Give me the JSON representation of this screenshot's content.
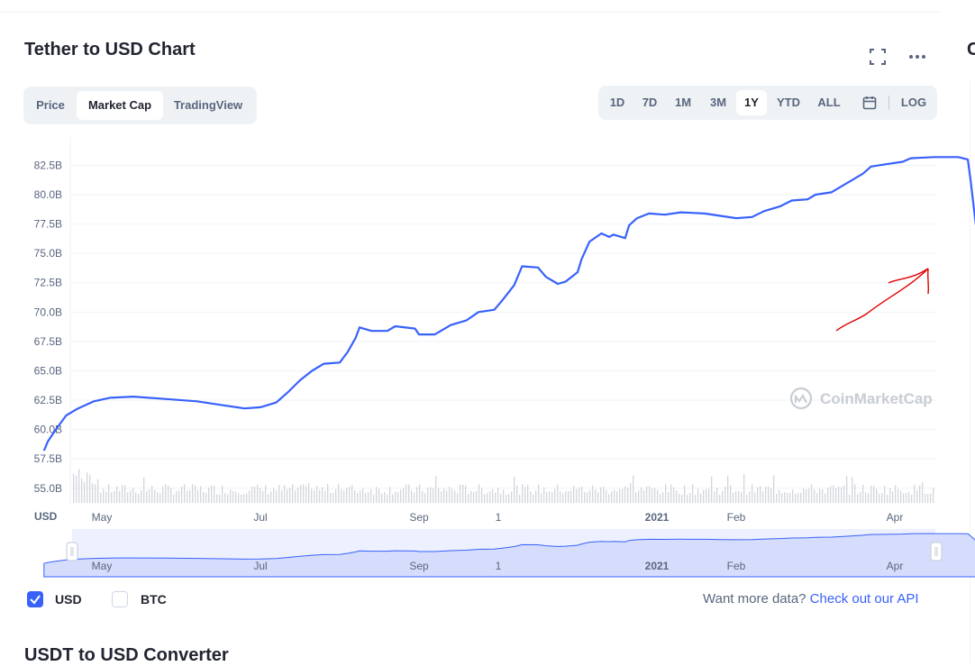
{
  "header": {
    "title": "Tether to USD Chart",
    "right_edge_char": "C"
  },
  "tabs": [
    {
      "label": "Price",
      "active": false
    },
    {
      "label": "Market Cap",
      "active": true
    },
    {
      "label": "TradingView",
      "active": false
    }
  ],
  "ranges": [
    {
      "label": "1D",
      "active": false
    },
    {
      "label": "7D",
      "active": false
    },
    {
      "label": "1M",
      "active": false
    },
    {
      "label": "3M",
      "active": false
    },
    {
      "label": "1Y",
      "active": true
    },
    {
      "label": "YTD",
      "active": false
    },
    {
      "label": "ALL",
      "active": false
    }
  ],
  "log_label": "LOG",
  "icons": [
    "fullscreen-icon",
    "more-icon",
    "calendar-icon",
    "coinmarketcap-logo-icon"
  ],
  "watermark": "CoinMarketCap",
  "legend": {
    "usd_label": "USD",
    "btc_label": "BTC",
    "usd_checked": true,
    "btc_checked": false
  },
  "more_data": {
    "text": "Want more data?",
    "link": "Check out our API"
  },
  "converter_title": "USDT to USD Converter",
  "colors": {
    "line": "#3861fb",
    "accent": "#3861fb",
    "annotation": "#e10000",
    "grid": "#eff2f5",
    "label": "#58667e"
  },
  "chart_data": {
    "type": "line",
    "y_unit_label": "USD",
    "ylim": [
      53.6,
      84.3
    ],
    "yticks": [
      "55.0B",
      "57.5B",
      "60.0B",
      "62.5B",
      "65.0B",
      "67.5B",
      "70.0B",
      "72.5B",
      "75.0B",
      "77.5B",
      "80.0B",
      "82.5B"
    ],
    "ytick_values": [
      55.0,
      57.5,
      60.0,
      62.5,
      65.0,
      67.5,
      70.0,
      72.5,
      75.0,
      77.5,
      80.0,
      82.5
    ],
    "xticks": [
      {
        "label": "May",
        "x": 1.0,
        "bold": false
      },
      {
        "label": "Jul",
        "x": 3.0,
        "bold": false
      },
      {
        "label": "Sep",
        "x": 5.0,
        "bold": false
      },
      {
        "label": "1",
        "x": 6.0,
        "bold": false
      },
      {
        "label": "2021",
        "x": 8.0,
        "bold": true
      },
      {
        "label": "Feb",
        "x": 9.0,
        "bold": false
      },
      {
        "label": "Apr",
        "x": 11.0,
        "bold": false
      }
    ],
    "xlim": [
      0.27,
      11.55
    ],
    "series": [
      {
        "values": [
          [
            0.27,
            58.2
          ],
          [
            0.32,
            59.0
          ],
          [
            0.42,
            60.0
          ],
          [
            0.55,
            61.2
          ],
          [
            0.7,
            61.8
          ],
          [
            0.9,
            62.4
          ],
          [
            1.1,
            62.7
          ],
          [
            1.4,
            62.8
          ],
          [
            1.8,
            62.6
          ],
          [
            2.2,
            62.4
          ],
          [
            2.5,
            62.1
          ],
          [
            2.8,
            61.8
          ],
          [
            3.0,
            61.9
          ],
          [
            3.2,
            62.3
          ],
          [
            3.35,
            63.2
          ],
          [
            3.5,
            64.2
          ],
          [
            3.65,
            65.0
          ],
          [
            3.8,
            65.6
          ],
          [
            4.0,
            65.7
          ],
          [
            4.1,
            66.6
          ],
          [
            4.2,
            67.8
          ],
          [
            4.25,
            68.7
          ],
          [
            4.4,
            68.4
          ],
          [
            4.6,
            68.4
          ],
          [
            4.7,
            68.8
          ],
          [
            4.95,
            68.6
          ],
          [
            5.0,
            68.1
          ],
          [
            5.2,
            68.1
          ],
          [
            5.4,
            68.9
          ],
          [
            5.6,
            69.3
          ],
          [
            5.75,
            70.0
          ],
          [
            5.95,
            70.2
          ],
          [
            6.05,
            71.0
          ],
          [
            6.2,
            72.3
          ],
          [
            6.3,
            73.9
          ],
          [
            6.5,
            73.8
          ],
          [
            6.6,
            73.0
          ],
          [
            6.75,
            72.4
          ],
          [
            6.85,
            72.6
          ],
          [
            7.0,
            73.4
          ],
          [
            7.05,
            74.5
          ],
          [
            7.15,
            76.0
          ],
          [
            7.3,
            76.7
          ],
          [
            7.4,
            76.4
          ],
          [
            7.45,
            76.6
          ],
          [
            7.6,
            76.3
          ],
          [
            7.65,
            77.4
          ],
          [
            7.75,
            78.0
          ],
          [
            7.9,
            78.4
          ],
          [
            8.1,
            78.3
          ],
          [
            8.3,
            78.5
          ],
          [
            8.6,
            78.4
          ],
          [
            8.8,
            78.2
          ],
          [
            9.0,
            78.0
          ],
          [
            9.2,
            78.1
          ],
          [
            9.35,
            78.6
          ],
          [
            9.55,
            79.0
          ],
          [
            9.7,
            79.5
          ],
          [
            9.9,
            79.6
          ],
          [
            10.0,
            80.0
          ],
          [
            10.2,
            80.2
          ],
          [
            10.3,
            80.6
          ],
          [
            10.45,
            81.2
          ],
          [
            10.6,
            81.8
          ],
          [
            10.7,
            82.4
          ],
          [
            10.9,
            82.6
          ],
          [
            11.1,
            82.8
          ],
          [
            11.2,
            83.1
          ],
          [
            11.5,
            83.2
          ],
          [
            11.8,
            83.2
          ],
          [
            11.92,
            83.0
          ],
          [
            11.96,
            81.0
          ],
          [
            12.02,
            77.5
          ],
          [
            12.1,
            75.8
          ],
          [
            12.16,
            75.6
          ],
          [
            12.22,
            74.1
          ]
        ]
      }
    ]
  },
  "navigator": {
    "xticks": [
      "May",
      "Jul",
      "Sep",
      "1",
      "2021",
      "Feb",
      "Apr"
    ]
  }
}
